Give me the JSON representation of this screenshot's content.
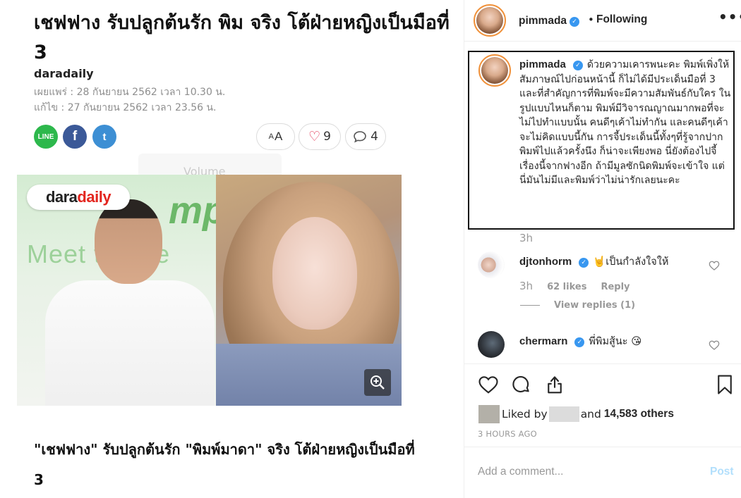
{
  "article": {
    "headline": "เชฟฟาง รับปลูกต้นรัก พิม จริง โต้ฝ่ายหญิงเป็นมือที่ 3",
    "source": "daradaily",
    "published": "เผยแพร่ : 28 กันยายน 2562 เวลา 10.30 น.",
    "edited": "แก้ไข : 27 กันยายน 2562 เวลา 23.56 น.",
    "share": {
      "line_label": "LINE",
      "facebook_label": "f",
      "twitter_label": "t"
    },
    "font_size_small": "A",
    "font_size_large": "A",
    "likes_count": "9",
    "comments_count": "4",
    "volume_hint": "Volume",
    "image": {
      "brand_part1": "dara",
      "brand_part2": "daily",
      "bg_text_1": "Meet t   Expe",
      "bg_text_2": "mple"
    },
    "subheadline": "\"เชฟฟาง\" รับปลูกต้นรัก \"พิมพ์มาดา\" จริง โต้ฝ่ายหญิงเป็นมือที่ 3"
  },
  "instagram": {
    "username": "pimmada",
    "following_label": "Following",
    "dot": "•",
    "more_label": "•••",
    "caption": "ด้วยความเคารพนะคะ พิมพ์เพิ่งให้สัมภาษณ์ไปก่อนหน้านี้ ก็ไม่ได้มีประเด็นมือที่ 3 และที่สำคัญการที่พิมพ์จะมีความสัมพันธ์กับใคร ในรูปแบบไหนก็ตาม พิมพ์มีวิจารณญาณมากพอที่จะไม่ไปทำแบบนั้น คนดีๆเค้าไม่ทำกัน และคนดีๆเค้าจะไม่คิดแบบนี้กัน การจี้ประเด็นนี้ทั้งๆที่รู้จากปากพิมพ์ไปแล้วครั้งนึง ก็น่าจะเพียงพอ นี่ยังต้องไปจี้เรื่องนี้จากฟางอีก ถ้ามีมูลซักนิดพิมพ์จะเข้าใจ แต่นี่มันไม่มีและพิมพ์ว่าไม่น่ารักเลยนะคะ",
    "caption_time": "3h",
    "comments": [
      {
        "username": "djtonhorm",
        "text": "🤘เป็นกำลังใจให้",
        "time": "3h",
        "likes": "62 likes",
        "reply_label": "Reply",
        "view_replies": "View replies (1)"
      },
      {
        "username": "chermarn",
        "text": "พี่พิมสู้นะ 😘"
      }
    ],
    "liked_by_label": "Liked by",
    "liked_and_label": "and",
    "liked_others": "14,583 others",
    "time_ago": "3 HOURS AGO",
    "add_comment_placeholder": "Add a comment...",
    "post_label": "Post"
  },
  "colors": {
    "instagram_blue": "#3897f0",
    "line_green": "#2db84c",
    "facebook_blue": "#3b5998",
    "twitter_blue": "#3d8fd4",
    "brand_red": "#e3261f",
    "heart_red": "#e0284a",
    "post_disabled": "#b2dffc"
  },
  "icons": {
    "share": [
      "line-icon",
      "facebook-icon",
      "twitter-icon"
    ],
    "actions": [
      "heart-icon",
      "comment-icon",
      "share-icon",
      "bookmark-icon"
    ],
    "image": "zoom-in-icon"
  }
}
